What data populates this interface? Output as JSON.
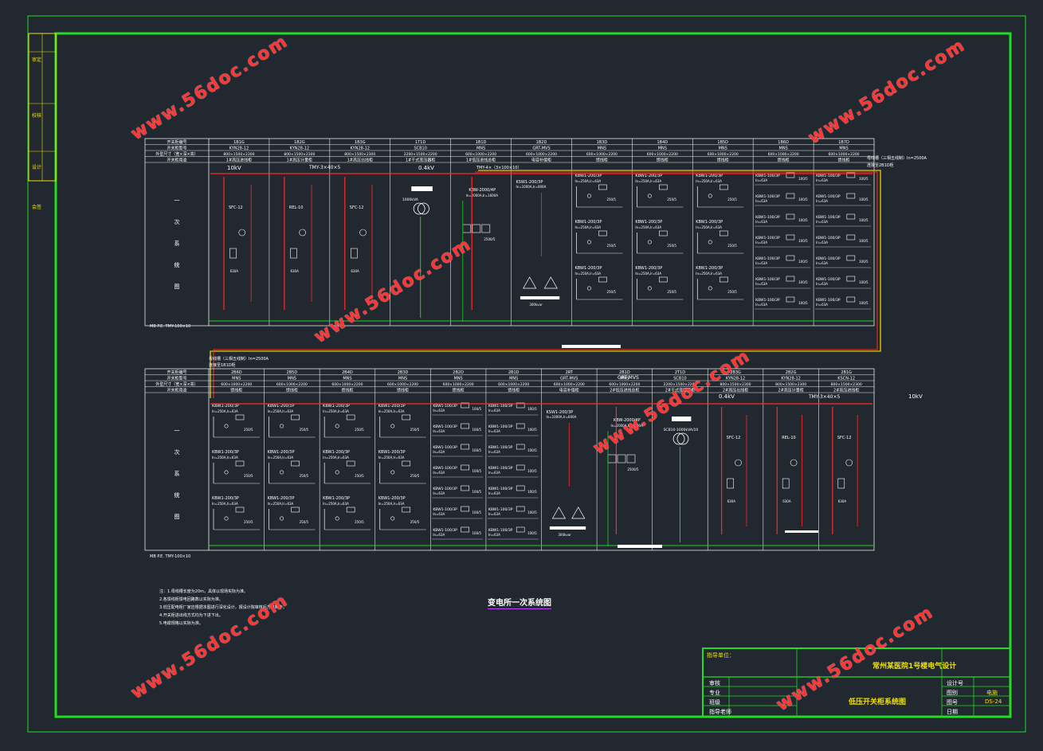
{
  "drawing_title": "变电所一次系统图",
  "voltage_labels": {
    "hv_top": "10kV",
    "lv_top": "0.4kV",
    "lv_bottom": "0.4kV",
    "hv_bottom": "10kV"
  },
  "busbar_labels": {
    "top_left": "TMY-3×40×5",
    "top_bus_mid": "TMY-4×（3×100×10）",
    "pe_top": "MB P.E. TMY-100×10",
    "bottom_bus": "母线槽（三相五线制）In=2500A",
    "bottom_bus_sub": "连接至1B1D柜",
    "pe_bottom": "MB P.E. TMY-100×10",
    "bottom_right": "TMY-3×40×5",
    "top_right_bus": "母线槽（三相五线制）In=2500A",
    "top_right_bus_sub": "连接至2B1D柜",
    "mid_cabinet": "GRT-MVS"
  },
  "row_headers": [
    "开关柜编号",
    "开关柜型号",
    "外型尺寸（宽×深×高）",
    "开关柜用途"
  ],
  "side_label_chars": [
    "一",
    "次",
    "系",
    "统",
    "图"
  ],
  "top_panels": [
    {
      "id": "1B1G",
      "type": "KYN28-12",
      "size": "800×1500×2300",
      "use": "1#高压进线柜",
      "device": "SFC-12"
    },
    {
      "id": "1B2G",
      "type": "KYN28-12",
      "size": "800×1500×2300",
      "use": "1#高压计量柜",
      "device": "REL-10"
    },
    {
      "id": "1B3G",
      "type": "KYN28-12",
      "size": "800×1500×2300",
      "use": "1#高压出线柜",
      "device": "SFC-12"
    },
    {
      "id": "1T1D",
      "type": "SCB10",
      "size": "2200×1500×2200",
      "use": "1#干式变压器柜",
      "device": "1000kVA"
    },
    {
      "id": "1B1D",
      "type": "MNS",
      "size": "600×1000×2200",
      "use": "1#低压进线总柜",
      "device": "KBW-2000/4P"
    },
    {
      "id": "1B2D",
      "type": "GRT-MVS",
      "size": "600×1000×2200",
      "use": "电容补偿柜",
      "device": "KSW1-200/3P"
    },
    {
      "id": "1B3D",
      "type": "MNS",
      "size": "600×1000×2200",
      "use": "馈线柜",
      "device": "KBW1-200/3P"
    },
    {
      "id": "1B4D",
      "type": "MNS",
      "size": "600×1000×2200",
      "use": "馈线柜",
      "device": "KBW1-200/3P"
    },
    {
      "id": "1B5D",
      "type": "MNS",
      "size": "600×1000×2200",
      "use": "馈线柜",
      "device": "KBW1-200/3P"
    },
    {
      "id": "1B6D",
      "type": "MNS",
      "size": "600×1000×2200",
      "use": "馈线柜",
      "device": "KBW1-100/3P"
    },
    {
      "id": "1B7D",
      "type": "MNS",
      "size": "600×1000×2200",
      "use": "馈线柜",
      "device": "KBW1-100/3P"
    }
  ],
  "bottom_panels": [
    {
      "id": "2B6D",
      "type": "MNS",
      "size": "600×1000×2200",
      "use": "馈线柜",
      "device": "KBW1-200/3P"
    },
    {
      "id": "2B5D",
      "type": "MNS",
      "size": "600×1000×2200",
      "use": "馈线柜",
      "device": "KBW1-200/3P"
    },
    {
      "id": "2B4D",
      "type": "MNS",
      "size": "600×1000×2200",
      "use": "馈线柜",
      "device": "KBW1-200/3P"
    },
    {
      "id": "2B3D",
      "type": "MNS",
      "size": "600×1000×2200",
      "use": "馈线柜",
      "device": "KBW1-200/3P"
    },
    {
      "id": "2B2D",
      "type": "MNS",
      "size": "600×1000×2200",
      "use": "馈线柜",
      "device": "KBW1-100/3P"
    },
    {
      "id": "2B1D",
      "type": "MNS",
      "size": "600×1000×2200",
      "use": "馈线柜",
      "device": "KBW1-100/3P"
    },
    {
      "id": "2RT",
      "type": "GRT-MVS",
      "size": "600×1000×2200",
      "use": "电容补偿柜",
      "device": "KSW1-200/3P"
    },
    {
      "id": "2B1D",
      "type": "MNS",
      "size": "600×1000×2200",
      "use": "2#低压进线总柜",
      "device": "KBW-2000/4P"
    },
    {
      "id": "2T1D",
      "type": "SCB10",
      "size": "2200×1500×2200",
      "use": "2#干式变压器柜",
      "device": "SCB10-1000kVA/10"
    },
    {
      "id": "2B3G",
      "type": "KYN28-12",
      "size": "800×1500×2300",
      "use": "2#高压出线柜",
      "device": "SFC-12"
    },
    {
      "id": "2B2G",
      "type": "KYN28-12",
      "size": "800×1500×2300",
      "use": "2#高压计量柜",
      "device": "REL-10"
    },
    {
      "id": "2B1G",
      "type": "KSCN-12",
      "size": "800×1500×2300",
      "use": "2#高压进线柜",
      "device": "SFC-12"
    }
  ],
  "notes": [
    "注：1.母线槽长度为20m，具体以现场实际为准。",
    "2.各馈线柜馈电回路数以实际为准。",
    "3.低压配电柜厂家应根据本图进行深化设计，报设计院审核后方可制作。",
    "4.开关柜进出线方式均为下进下出。",
    "5.电缆规格以实际为准。"
  ],
  "title_block": {
    "school_label": "指导单位：",
    "project_title": "常州某医院1号楼电气设计",
    "drawing_name": "低压开关柜系统图",
    "rows_left": [
      "审核",
      "专业",
      "班级",
      "指导老师"
    ],
    "rows_right": [
      "设计号",
      "图别",
      "图号",
      "日期"
    ],
    "right_values": [
      "",
      "电施",
      "DS-24",
      ""
    ]
  },
  "side_bar": {
    "labels": [
      "审定",
      "校核",
      "设计",
      "会签"
    ]
  },
  "watermark": "www.56doc.com",
  "colors": {
    "background": "#212830",
    "frame": "#22dd22",
    "line_white": "#e8e8e8",
    "busbar_red": "#ff2a2a",
    "ground_green": "#20d020",
    "text_yellow": "#f0e000",
    "watermark": "#ff3535"
  }
}
